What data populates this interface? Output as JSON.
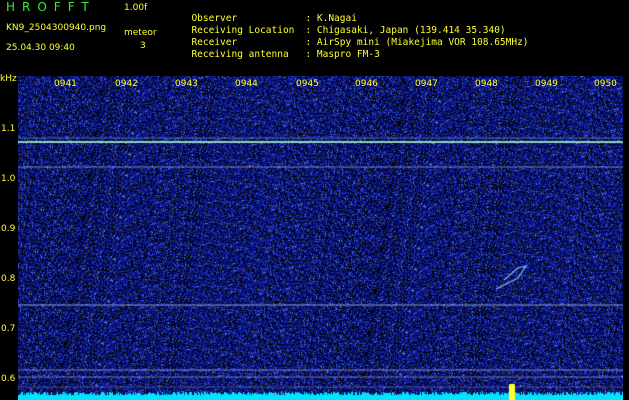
{
  "header": {
    "app_title": "HROFFT",
    "version": "1.00f",
    "filename": "KN9_2504300940.png",
    "mode": "meteor",
    "datetime": "25.04.30 09:40",
    "count": "3"
  },
  "info": [
    {
      "label": "Observer",
      "value": ": K.Nagai"
    },
    {
      "label": "Receiving Location",
      "value": ": Chigasaki, Japan (139.414 35.340)"
    },
    {
      "label": "Receiver",
      "value": ": AirSpy mini (Miakejima VOR 108.65MHz)"
    },
    {
      "label": "Receiving antenna",
      "value": ": Maspro FM-3"
    }
  ],
  "axis": {
    "unit": "kHz",
    "y_ticks": [
      "1.1",
      "1.0",
      "0.9",
      "0.8",
      "0.7",
      "0.6"
    ],
    "x_ticks": [
      "0941",
      "0942",
      "0943",
      "0944",
      "0945",
      "0946",
      "0947",
      "0948",
      "0949",
      "0950"
    ]
  },
  "colors": {
    "background": "#000000",
    "noise": "#1a2a9a",
    "signal": "#66ffcc",
    "level": "#00e5ff",
    "text": "#ffff33"
  }
}
